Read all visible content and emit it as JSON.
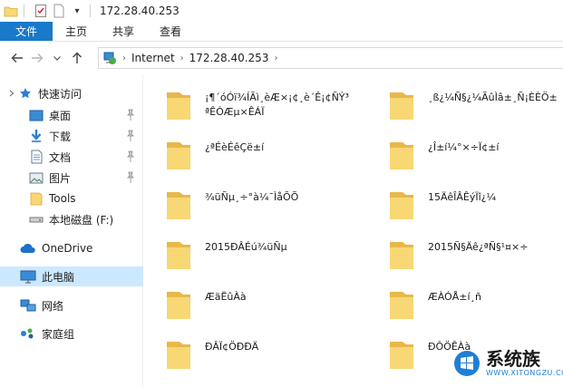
{
  "titlebar": {
    "title": "172.28.40.253",
    "dropdown_glyph": "▾"
  },
  "ribbon": {
    "tabs": [
      "文件",
      "主页",
      "共享",
      "查看"
    ]
  },
  "address": {
    "crumbs": [
      "Internet",
      "172.28.40.253"
    ]
  },
  "sidebar": {
    "items": [
      {
        "label": "快速访问",
        "icon": "star-icon"
      },
      {
        "label": "桌面",
        "icon": "desktop-icon",
        "pinned": true
      },
      {
        "label": "下载",
        "icon": "download-icon",
        "pinned": true
      },
      {
        "label": "文档",
        "icon": "document-icon",
        "pinned": true
      },
      {
        "label": "图片",
        "icon": "picture-icon",
        "pinned": true
      },
      {
        "label": "Tools",
        "icon": "folder-icon"
      },
      {
        "label": "本地磁盘 (F:)",
        "icon": "drive-icon"
      },
      {
        "label": "OneDrive",
        "icon": "cloud-icon"
      },
      {
        "label": "此电脑",
        "icon": "computer-icon",
        "selected": true
      },
      {
        "label": "网络",
        "icon": "network-icon"
      },
      {
        "label": "家庭组",
        "icon": "homegroup-icon"
      }
    ]
  },
  "folders": {
    "left": [
      "¡¶´óÓï¾ÍÃì¸èÆ×¡¢¸è´Ê¡¢ÑÝ³ªÊÓÆµ×ÊÁÏ",
      "¿ªÉèÉêÇë±í",
      "¾üÑµ¸÷°à¼¯ÌåÕÕ",
      "2015ÐÂÉú¾üÑµ",
      "ÆäËûÀà",
      "ÐÂÏ¢ÖÐÐÄ"
    ],
    "right": [
      "¸ß¿¼Ñ§¿¼ÃûÌâ±¸Ñ¡ÈÈÖ±",
      "¿Î±í¼°×÷Ï¢±í",
      "15ÄêÎÂÊýÏî¿¼",
      "2015Ñ§Äê¿ªÑ§¹¤×÷",
      "ÆÀÓÅ±í¸ñ",
      "ÐÔÖÊÀà"
    ]
  },
  "watermark": {
    "name": "系统族",
    "url": "WWW.XITONGZU.COM"
  },
  "colors": {
    "accent": "#1979ca",
    "selected": "#cce8ff",
    "folder": "#f8d775",
    "folder_dark": "#e7b84a"
  }
}
